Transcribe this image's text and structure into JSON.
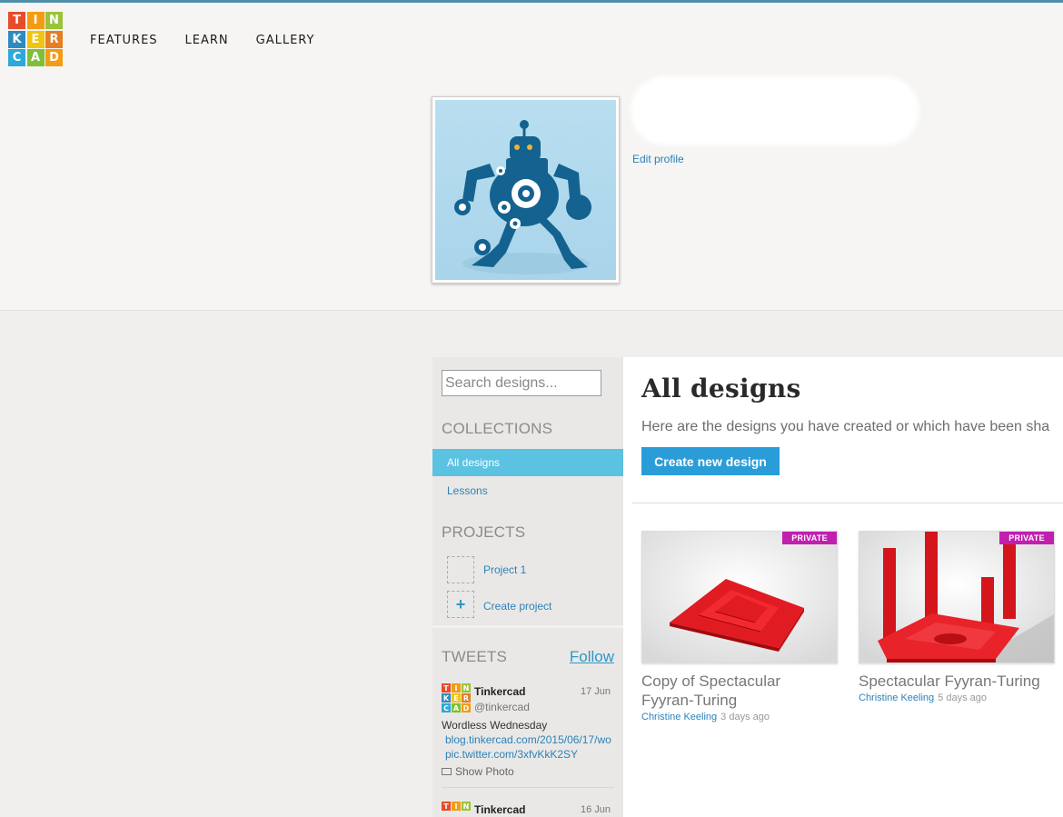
{
  "logo": {
    "letters": [
      "T",
      "I",
      "N",
      "K",
      "E",
      "R",
      "C",
      "A",
      "D"
    ],
    "colors": [
      "#e74c2b",
      "#f39c12",
      "#9ac33a",
      "#2e8bc0",
      "#f1c40f",
      "#e67e22",
      "#2ea8d8",
      "#7fbf3a",
      "#f39c12"
    ]
  },
  "nav": {
    "items": [
      "FEATURES",
      "LEARN",
      "GALLERY"
    ]
  },
  "profile": {
    "edit_label": "Edit profile"
  },
  "sidebar": {
    "search_placeholder": "Search designs...",
    "collections_title": "COLLECTIONS",
    "collections": [
      "All designs",
      "Lessons"
    ],
    "projects_title": "PROJECTS",
    "projects": [
      "Project 1"
    ],
    "create_project_label": "Create project",
    "create_project_icon": "+",
    "tweets_title": "TWEETS",
    "follow_label": "Follow",
    "tweets": [
      {
        "name": "Tinkercad",
        "handle": "@tinkercad",
        "date": "17 Jun",
        "text": "Wordless Wednesday",
        "link1": "blog.tinkercad.com/2015/06/17/wo",
        "link2": "pic.twitter.com/3xfvKkK2SY",
        "action": "Show Photo"
      },
      {
        "name": "Tinkercad",
        "date": "16 Jun"
      }
    ]
  },
  "main": {
    "title": "All designs",
    "description": "Here are the designs you have created or which have been sha",
    "create_button": "Create new design",
    "designs": [
      {
        "badge": "PRIVATE",
        "title_line1": "Copy of Spectacular",
        "title_line2": "Fyyran-Turing",
        "author": "Christine Keeling",
        "ago": "3 days ago"
      },
      {
        "badge": "PRIVATE",
        "title_line1": "Spectacular Fyyran-Turing",
        "author": "Christine Keeling",
        "ago": "5 days ago"
      }
    ]
  },
  "colors": {
    "accent": "#2a9dd9",
    "active_item": "#5bc2e2",
    "private_badge": "#c01fb0",
    "link": "#2b82b8"
  }
}
